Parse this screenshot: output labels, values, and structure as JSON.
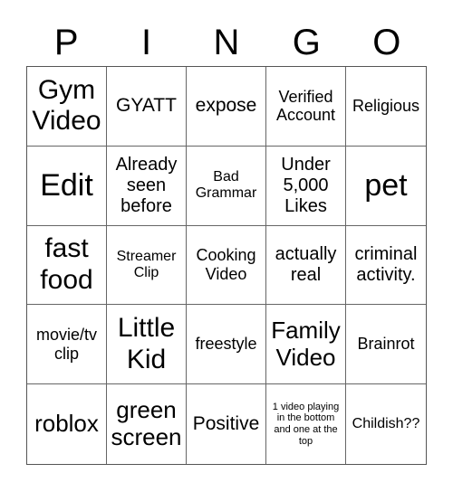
{
  "header": [
    "P",
    "I",
    "N",
    "G",
    "O"
  ],
  "cells": [
    {
      "text": "Gym Video",
      "size": "s30"
    },
    {
      "text": "GYATT",
      "size": "s21"
    },
    {
      "text": "expose",
      "size": "s21"
    },
    {
      "text": "Verified Account",
      "size": "s18"
    },
    {
      "text": "Religious",
      "size": "s18"
    },
    {
      "text": "Edit",
      "size": "s34"
    },
    {
      "text": "Already seen before",
      "size": "s20"
    },
    {
      "text": "Bad Grammar",
      "size": "s16"
    },
    {
      "text": "Under 5,000 Likes",
      "size": "s20"
    },
    {
      "text": "pet",
      "size": "s34"
    },
    {
      "text": "fast food",
      "size": "s30"
    },
    {
      "text": "Streamer Clip",
      "size": "s16"
    },
    {
      "text": "Cooking Video",
      "size": "s18"
    },
    {
      "text": "actually real",
      "size": "s20"
    },
    {
      "text": "criminal activity.",
      "size": "s20"
    },
    {
      "text": "movie/tv clip",
      "size": "s18"
    },
    {
      "text": "Little Kid",
      "size": "s30"
    },
    {
      "text": "freestyle",
      "size": "s18"
    },
    {
      "text": "Family Video",
      "size": "s26"
    },
    {
      "text": "Brainrot",
      "size": "s18"
    },
    {
      "text": "roblox",
      "size": "s26"
    },
    {
      "text": "green screen",
      "size": "s26"
    },
    {
      "text": "Positive",
      "size": "s21"
    },
    {
      "text": "1 video playing in the bottom and one at the top",
      "size": "s11"
    },
    {
      "text": "Childish??",
      "size": "s16"
    }
  ]
}
